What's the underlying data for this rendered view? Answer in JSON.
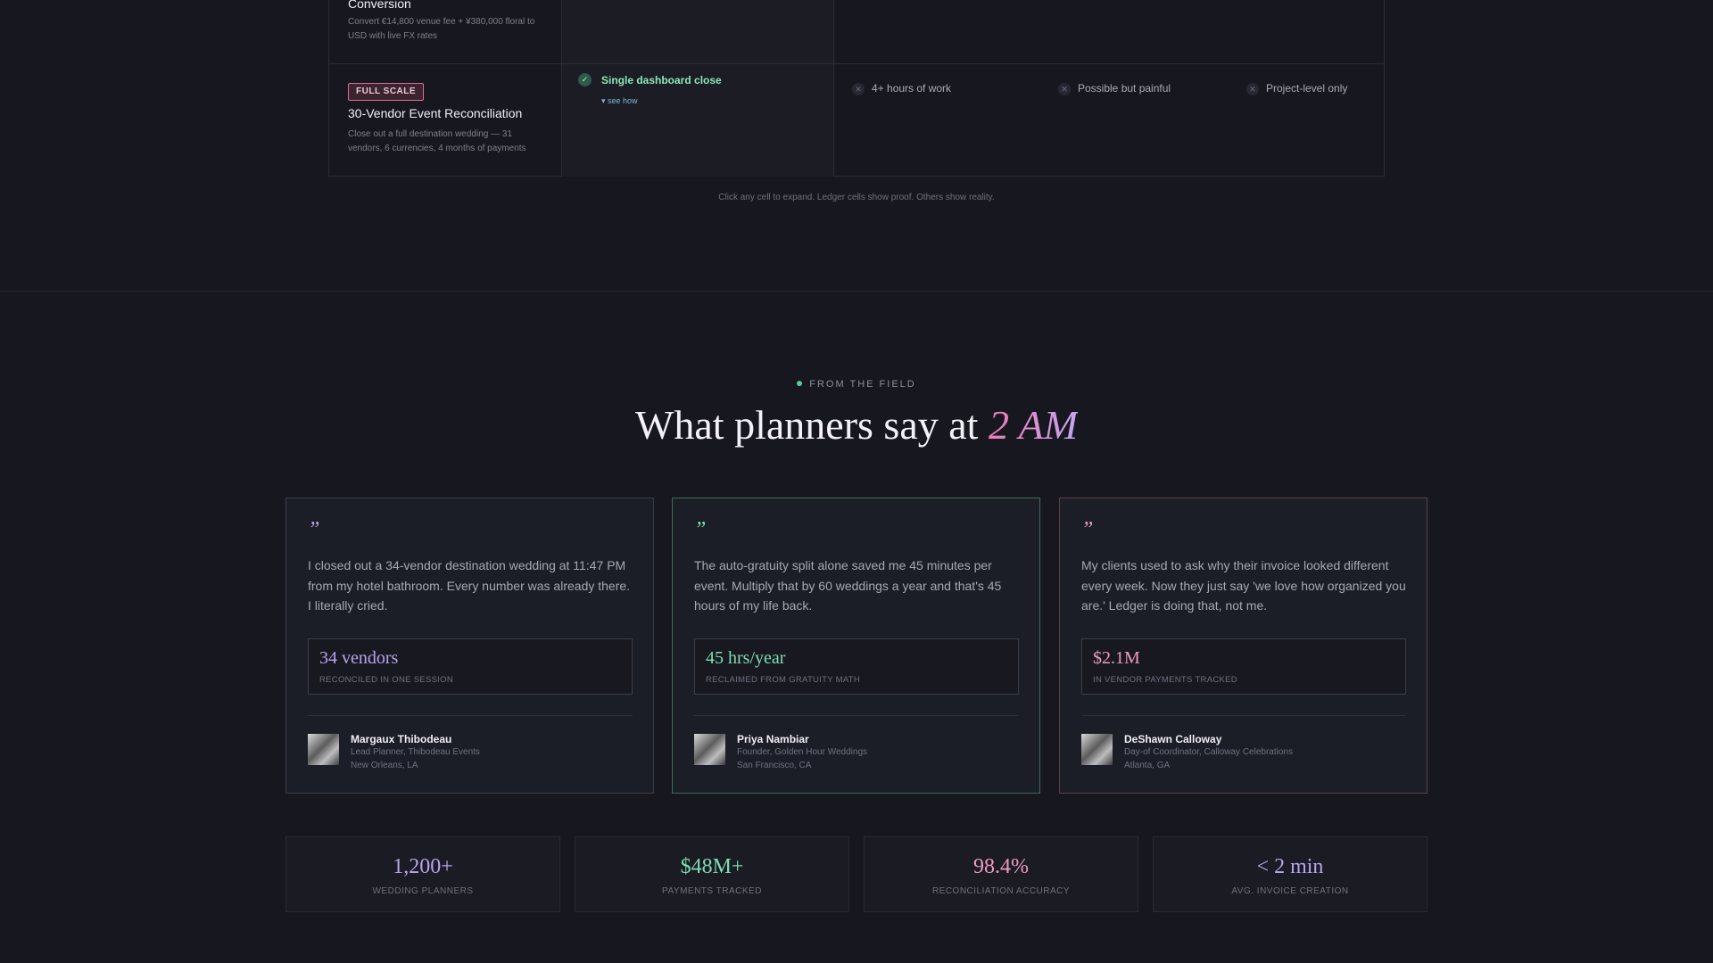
{
  "comparison": {
    "row1": {
      "title": "Conversion",
      "desc": "Convert €14,800 venue fee + ¥380,000 floral to USD with live FX rates"
    },
    "row2": {
      "badge": "FULL SCALE",
      "title": "30-Vendor Event Reconciliation",
      "desc": "Close out a full destination wedding — 31 vendors, 6 currencies, 4 months of payments",
      "ledger": {
        "claim": "Single dashboard close",
        "see_how": "▾ see how"
      },
      "others": [
        "4+ hours of work",
        "Possible but painful",
        "Project-level only"
      ]
    },
    "note": "Click any cell to expand. Ledger cells show proof. Others show reality."
  },
  "testimonials": {
    "eyebrow": "FROM THE FIELD",
    "heading": "What planners say at",
    "heading_accent": "2 AM",
    "quote_mark": "”",
    "cards": [
      {
        "quote": "I closed out a 34-vendor destination wedding at 11:47 PM from my hotel bathroom. Every number was already there. I literally cried.",
        "metric_value": "34 vendors",
        "metric_label": "RECONCILED IN ONE SESSION",
        "name": "Margaux Thibodeau",
        "role": "Lead Planner, Thibodeau Events",
        "location": "New Orleans, LA"
      },
      {
        "quote": "The auto-gratuity split alone saved me 45 minutes per event. Multiply that by 60 weddings a year and that's 45 hours of my life back.",
        "metric_value": "45 hrs/year",
        "metric_label": "RECLAIMED FROM GRATUITY MATH",
        "name": "Priya Nambiar",
        "role": "Founder, Golden Hour Weddings",
        "location": "San Francisco, CA"
      },
      {
        "quote": "My clients used to ask why their invoice looked different every week. Now they just say 'we love how organized you are.' Ledger is doing that, not me.",
        "metric_value": "$2.1M",
        "metric_label": "IN VENDOR PAYMENTS TRACKED",
        "name": "DeShawn Calloway",
        "role": "Day-of Coordinator, Calloway Celebrations",
        "location": "Atlanta, GA"
      }
    ]
  },
  "stats": [
    {
      "value": "1,200+",
      "label": "WEDDING PLANNERS",
      "color": "#b9a4ee"
    },
    {
      "value": "$48M+",
      "label": "PAYMENTS TRACKED",
      "color": "#7fdcb0"
    },
    {
      "value": "98.4%",
      "label": "RECONCILIATION ACCURACY",
      "color": "#f09ac4"
    },
    {
      "value": "< 2 min",
      "label": "AVG. INVOICE CREATION",
      "color": "#b9a4ee"
    }
  ],
  "icons": {
    "check": "check-icon",
    "cross": "x-icon",
    "dot": "status-dot-icon"
  }
}
